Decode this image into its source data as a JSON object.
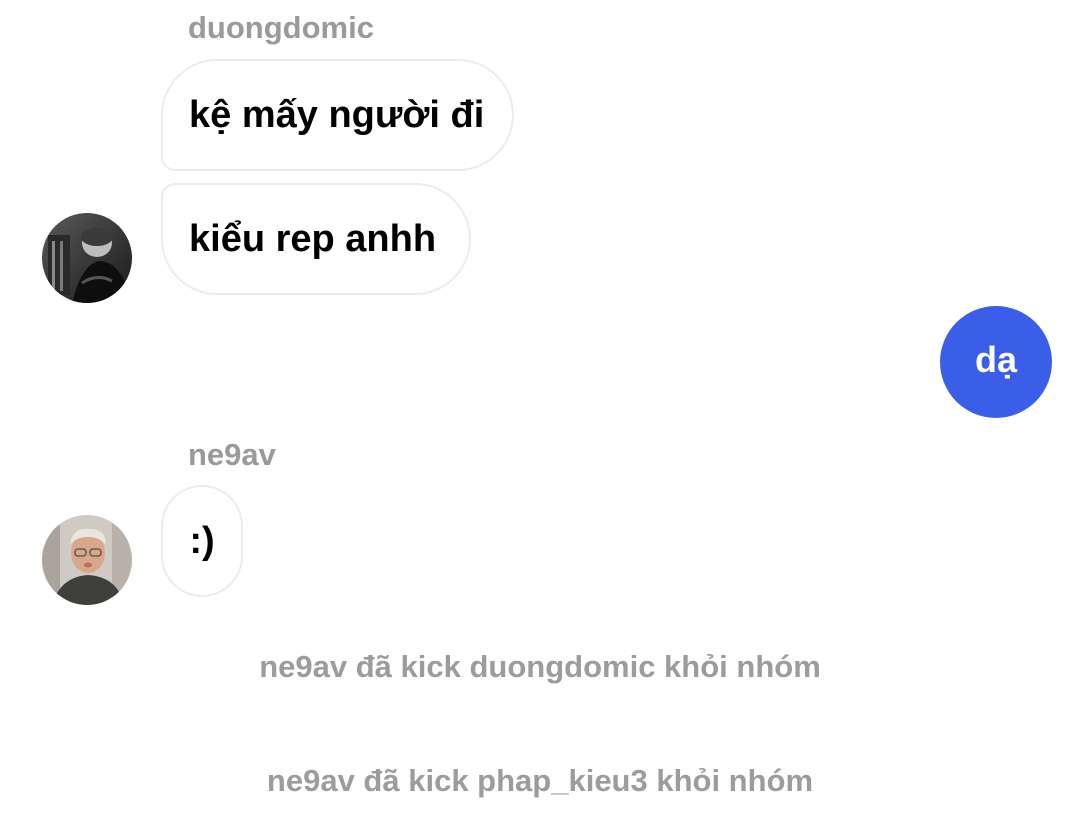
{
  "messages": [
    {
      "sender": "duongdomic",
      "bubbles": [
        "kệ mấy người đi",
        "kiểu rep anhh"
      ]
    },
    {
      "sender": "me",
      "bubbles": [
        "dạ"
      ]
    },
    {
      "sender": "ne9av",
      "bubbles": [
        ":)"
      ]
    }
  ],
  "system_messages": [
    "ne9av đã kick duongdomic khỏi nhóm",
    "ne9av đã kick phap_kieu3 khỏi nhóm"
  ],
  "colors": {
    "outgoing_bubble": "#3b5ee8",
    "sender_name": "#9a9a9a",
    "system_text": "#9c9c9c",
    "incoming_border": "#ececec"
  }
}
